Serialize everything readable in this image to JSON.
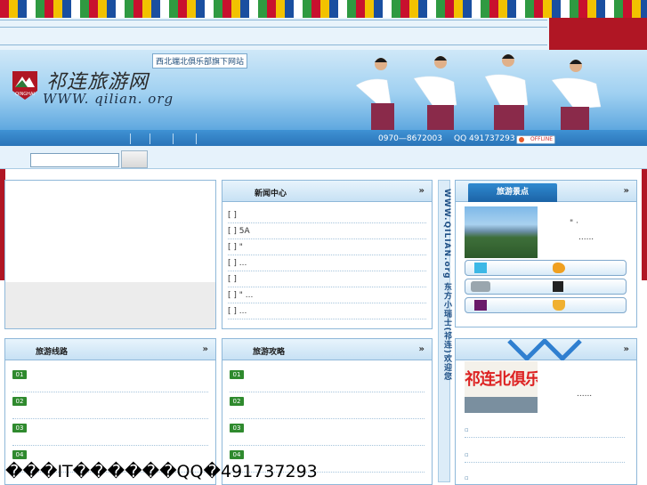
{
  "header": {
    "logo_text": "祁连旅游网",
    "logo_url": "WWW. qilian. org",
    "logo_badge": "QINGHAI",
    "tagline": "西北端北俱乐部旗下网站"
  },
  "nav": {
    "phone": "0970—8672003",
    "qq": "QQ 491737293",
    "status": "OFFLINE"
  },
  "search": {
    "placeholder": "",
    "button_label": ""
  },
  "news_panel": {
    "title": "新闻中心",
    "more": "»",
    "rows": [
      "[ ]",
      "[ ]        5A",
      "[ ]  \"",
      "[ ]                 ...",
      "[ ]",
      "[ ]                \" ...",
      "[ ]                 ..."
    ]
  },
  "right_panel_1": {
    "title": "旅游景点",
    "more": "»",
    "caption_1": "\"  ·",
    "caption_2": "......"
  },
  "side_vertical_text": "WWW.QILIAN.org  东方小瑞士(祁连)欢迎您",
  "left_list_panel": {
    "title": "旅游线路",
    "more": "»",
    "items": [
      "01",
      "02",
      "03",
      "04"
    ]
  },
  "mid_list_panel": {
    "title": "旅游攻略",
    "more": "»",
    "items": [
      "01",
      "02",
      "03",
      "04"
    ]
  },
  "right_panel_2": {
    "more": "»",
    "photo_sign": "祁连北俱乐部",
    "caption": "......"
  },
  "footer": {
    "text": "���IT������QQ�491737293"
  },
  "colors": {
    "accent_blue": "#2a74b8",
    "brand_red": "#b01624",
    "number_badge": "#2f8a2e"
  }
}
